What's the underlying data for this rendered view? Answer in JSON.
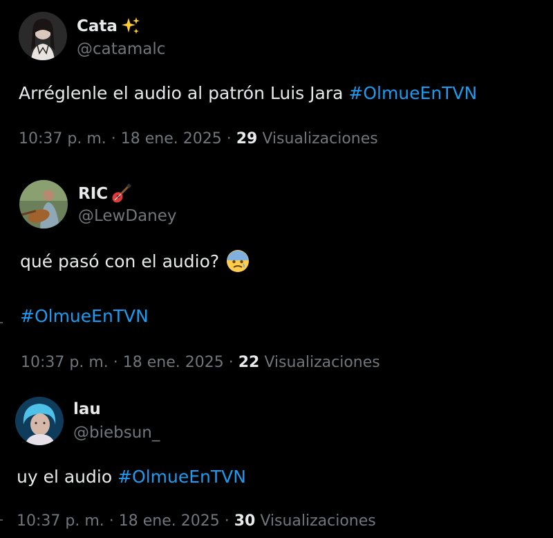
{
  "tweets": [
    {
      "display_name": "Cata",
      "name_emoji": "sparkles-icon",
      "handle": "@catamalc",
      "text": "Arréglenle el audio al patrón Luis Jara ",
      "hashtag": "#OlmueEnTVN",
      "time": "10:37 p. m. · 18 ene. 2025 · ",
      "views_count": "29",
      "views_label": " Visualizaciones"
    },
    {
      "display_name": "RIC",
      "name_emoji": "guitar-icon",
      "handle": "@LewDaney",
      "text": "qué pasó con el audio?",
      "text_emoji": "anxious-face-icon",
      "hashtag": "#OlmueEnTVN",
      "time": "10:37 p. m. · 18 ene. 2025 · ",
      "views_count": "22",
      "views_label": " Visualizaciones"
    },
    {
      "display_name": "lau",
      "handle": "@biebsun_",
      "text": "uy el audio ",
      "hashtag": "#OlmueEnTVN",
      "time": "10:37 p. m. · 18 ene. 2025 · ",
      "views_count": "30",
      "views_label": " Visualizaciones"
    }
  ],
  "colors": {
    "background": "#000000",
    "text": "#e7e9ea",
    "secondary": "#71767b",
    "hashtag": "#1d9bf0"
  }
}
